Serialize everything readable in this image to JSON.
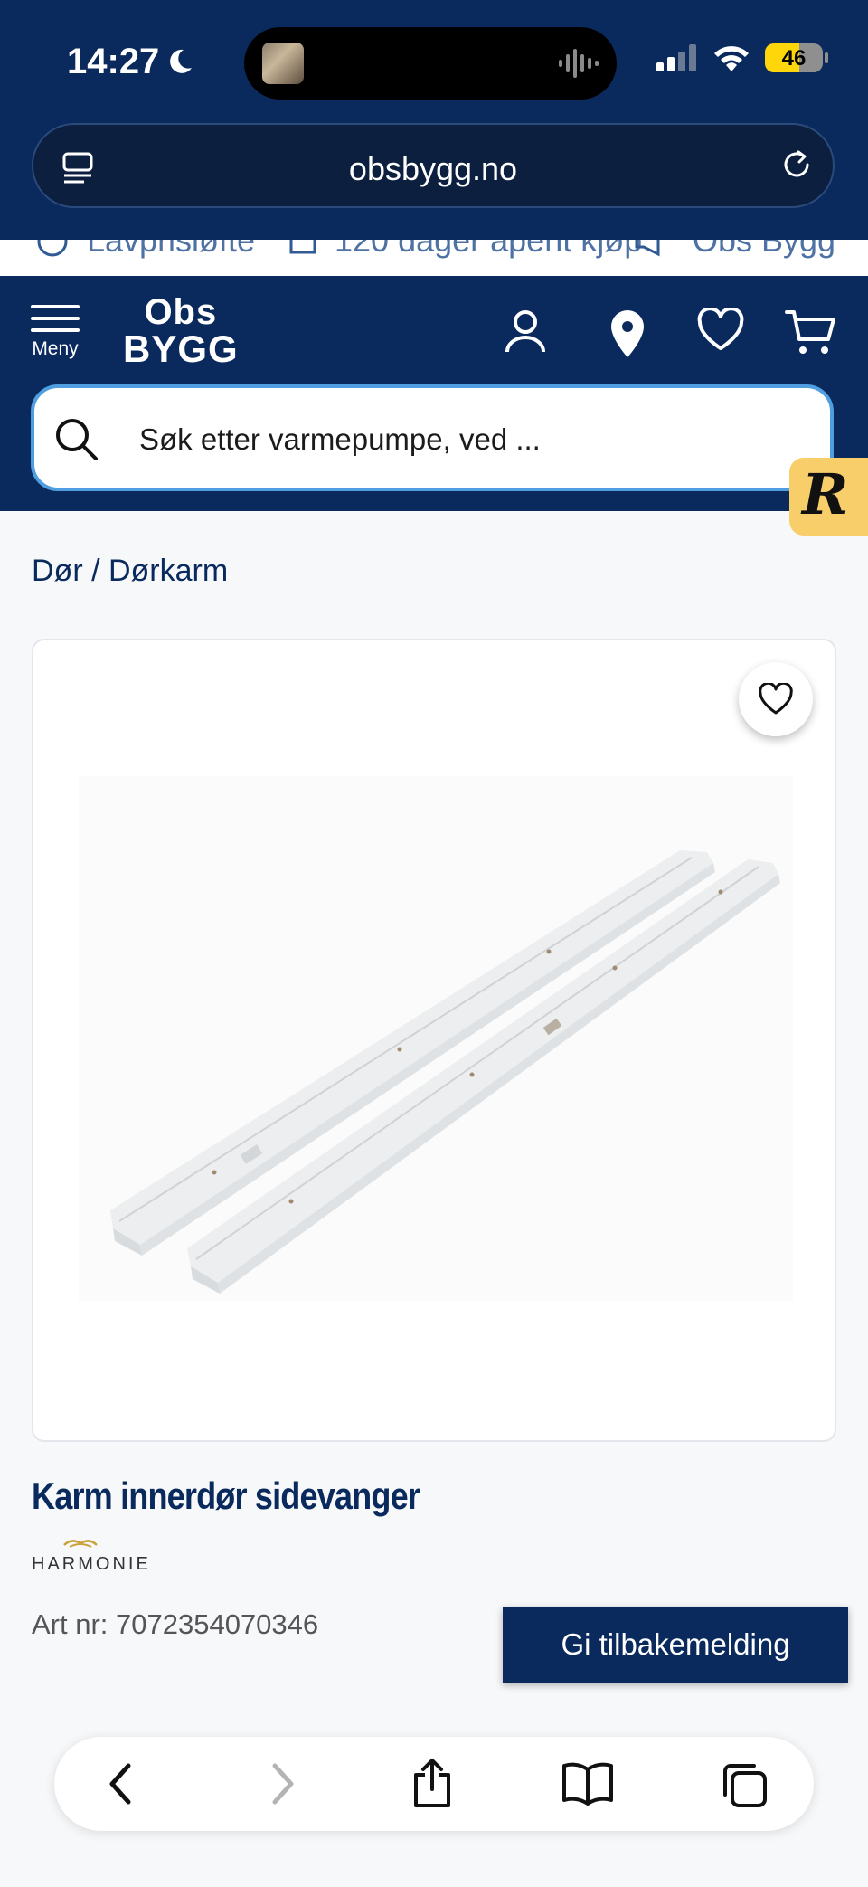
{
  "status": {
    "time": "14:27",
    "battery": "46"
  },
  "browser": {
    "url": "obsbygg.no"
  },
  "usp": [
    "Lavprisløfte",
    "120 dager åpent kjøp",
    "Obs Bygg"
  ],
  "header": {
    "menu_label": "Meny",
    "logo_line1": "Obs",
    "logo_line2": "BYGG",
    "search_placeholder": "Søk etter varmepumpe, ved ..."
  },
  "chat_badge": "R",
  "breadcrumb": "Dør / Dørkarm",
  "product": {
    "title": "Karm innerdør sidevanger",
    "brand": "HARMONIE",
    "art_nr": "Art nr: 7072354070346"
  },
  "feedback_label": "Gi tilbakemelding",
  "colors": {
    "navy": "#0a2a5e",
    "search_border": "#4f9ee0",
    "badge": "#f7ce6a"
  }
}
